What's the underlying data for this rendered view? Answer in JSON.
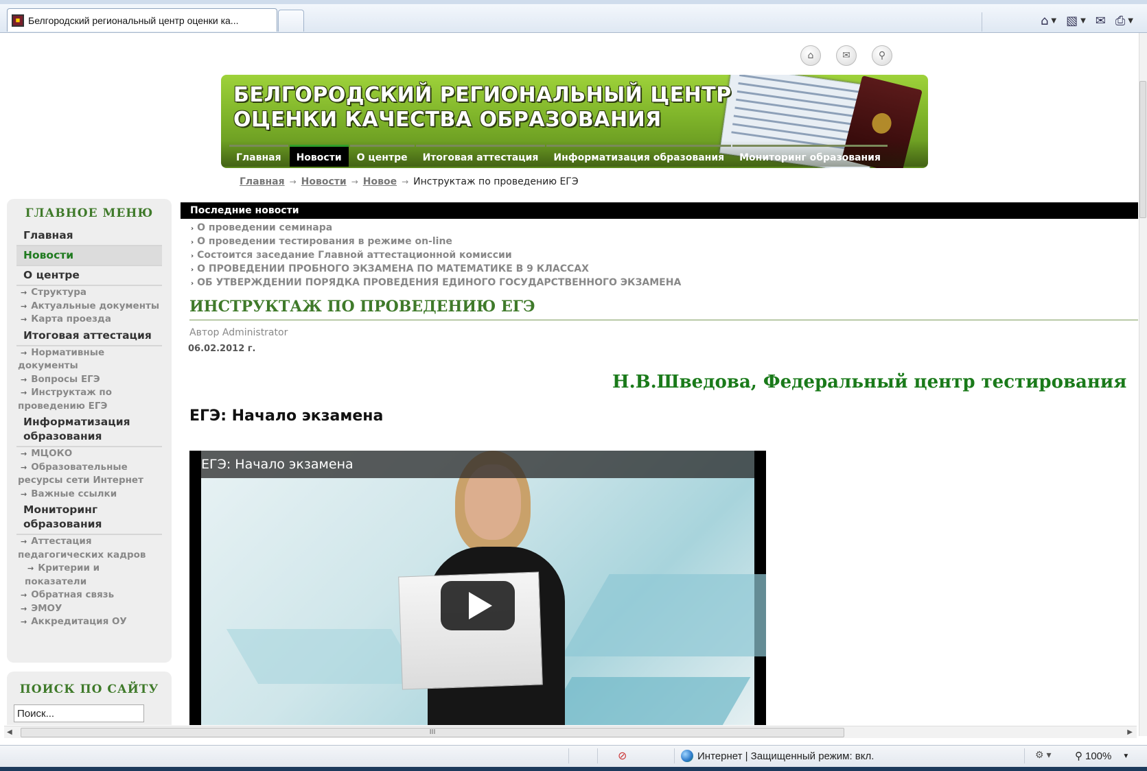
{
  "browser": {
    "tab_title": "Белгородский региональный центр оценки ка...",
    "status_zone": "Интернет | Защищенный режим: вкл.",
    "zoom": "100%",
    "hscroll_grip": "III"
  },
  "site": {
    "title_line1": "БЕЛГОРОДСКИЙ РЕГИОНАЛЬНЫЙ ЦЕНТР",
    "title_line2": "ОЦЕНКИ КАЧЕСТВА ОБРАЗОВАНИЯ",
    "nav": [
      "Главная",
      "Новости",
      "О центре",
      "Итоговая аттестация",
      "Информатизация образования",
      "Мониторинг образования"
    ]
  },
  "breadcrumb": {
    "items": [
      "Главная",
      "Новости",
      "Новое"
    ],
    "current": "Инструктаж по проведению ЕГЭ",
    "sep": "→"
  },
  "sidebar": {
    "heading": "ГЛАВНОЕ МЕНЮ",
    "main": "Главная",
    "news": "Новости",
    "about": "О центре",
    "about_sub": [
      "Структура",
      "Актуальные документы",
      "Карта проезда"
    ],
    "attest": "Итоговая аттестация",
    "attest_sub": [
      "Нормативные документы",
      "Вопросы ЕГЭ",
      "Инструктаж по проведению ЕГЭ"
    ],
    "inform": "Информатизация образования",
    "inform_sub": [
      "МЦОКО",
      "Образовательные ресурсы сети Интернет",
      "Важные ссылки"
    ],
    "monit": "Мониторинг образования",
    "monit_sub": [
      "Аттестация педагогических кадров",
      "Критерии и показатели",
      "Обратная связь",
      "ЭМОУ",
      "Аккредитация ОУ"
    ]
  },
  "search": {
    "heading": "ПОИСК ПО САЙТУ",
    "value": "Поиск..."
  },
  "latest": {
    "heading": "Последние новости",
    "items": [
      "О проведении семинара",
      "О проведении тестирования в режиме on-line",
      "Состоится заседание Главной аттестационной комиссии",
      "О ПРОВЕДЕНИИ ПРОБНОГО ЭКЗАМЕНА ПО МАТЕМАТИКЕ В 9 КЛАССАХ",
      "ОБ УТВЕРЖДЕНИИ ПОРЯДКА ПРОВЕДЕНИЯ ЕДИНОГО ГОСУДАРСТВЕННОГО ЭКЗАМЕНА"
    ]
  },
  "article": {
    "title": "ИНСТРУКТАЖ ПО ПРОВЕДЕНИЮ ЕГЭ",
    "author": "Автор Administrator",
    "date": "06.02.2012 г.",
    "speaker": "Н.В.Шведова, Федеральный центр тестирования",
    "subheading": "ЕГЭ: Начало экзамена",
    "video_title": "ЕГЭ: Начало экзамена"
  }
}
